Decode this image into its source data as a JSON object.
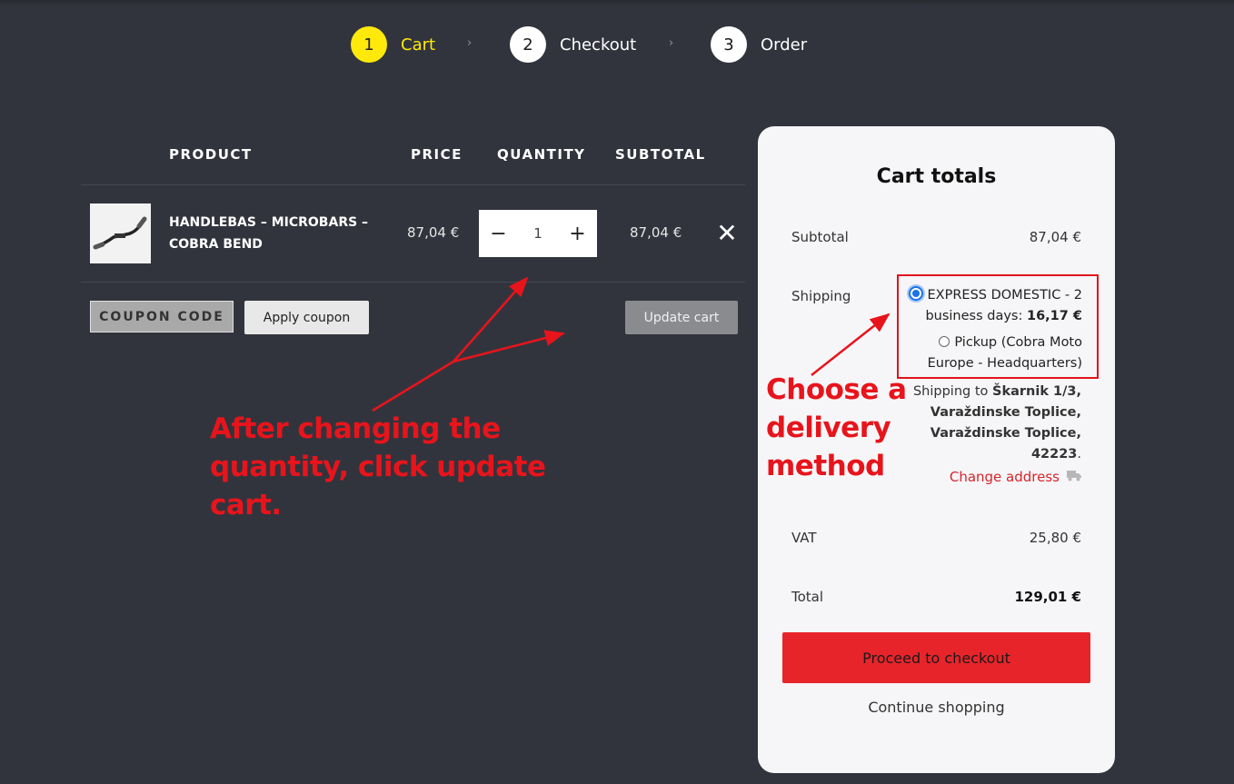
{
  "steps": [
    {
      "num": "1",
      "label": "Cart"
    },
    {
      "num": "2",
      "label": "Checkout"
    },
    {
      "num": "3",
      "label": "Order"
    }
  ],
  "step_separator": "›",
  "table": {
    "headers": {
      "product": "PRODUCT",
      "price": "PRICE",
      "quantity": "QUANTITY",
      "subtotal": "SUBTOTAL"
    },
    "rows": [
      {
        "name": "HANDLEBAS – MICROBARS – COBRA BEND",
        "price": "87,04 €",
        "quantity": "1",
        "subtotal": "87,04 €"
      }
    ],
    "qty_minus": "−",
    "qty_plus": "+",
    "remove_symbol": "✕"
  },
  "actions": {
    "coupon_placeholder": "COUPON CODE",
    "apply_coupon": "Apply coupon",
    "update_cart": "Update cart"
  },
  "annotations": {
    "note_quantity": "After changing the quantity, click update cart.",
    "note_delivery": "Choose a delivery method",
    "color": "#e8141c"
  },
  "totals": {
    "title": "Cart totals",
    "subtotal_label": "Subtotal",
    "subtotal_value": "87,04 €",
    "shipping_label": "Shipping",
    "shipping_options": [
      {
        "label": "EXPRESS DOMESTIC - 2 business days:",
        "price": "16,17 €",
        "selected": true
      },
      {
        "label": "Pickup (Cobra Moto Europe - Headquarters)",
        "price": "",
        "selected": false
      }
    ],
    "shipping_to_prefix": "Shipping to",
    "shipping_address": "Škarnik 1/3, Varaždinske Toplice, Varaždinske Toplice, 42223",
    "shipping_address_suffix": ".",
    "change_address": "Change address",
    "vat_label": "VAT",
    "vat_value": "25,80 €",
    "total_label": "Total",
    "total_value": "129,01 €",
    "proceed": "Proceed to checkout",
    "continue": "Continue shopping"
  },
  "colors": {
    "background": "#32343d",
    "active_step": "#ffe90a",
    "checkout_button": "#e8242b",
    "link_red": "#d9232a"
  }
}
